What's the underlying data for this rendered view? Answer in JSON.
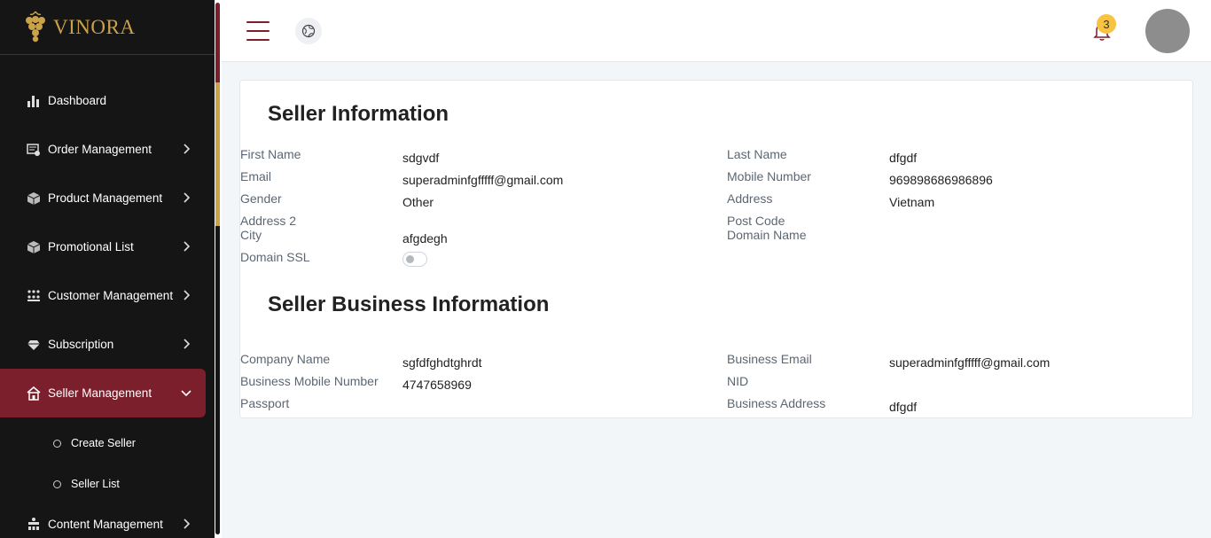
{
  "brand": {
    "name": "VINORA"
  },
  "sidebar": {
    "items": [
      {
        "label": "Dashboard",
        "icon": "bar-chart-icon"
      },
      {
        "label": "Order Management",
        "icon": "order-icon"
      },
      {
        "label": "Product Management",
        "icon": "box-icon"
      },
      {
        "label": "Promotional List",
        "icon": "box-icon"
      },
      {
        "label": "Customer Management",
        "icon": "users-icon"
      },
      {
        "label": "Subscription",
        "icon": "diamond-icon"
      },
      {
        "label": "Seller Management",
        "icon": "store-icon"
      },
      {
        "label": "Content Management",
        "icon": "content-icon"
      }
    ],
    "sub_items": [
      {
        "label": "Create Seller"
      },
      {
        "label": "Seller List"
      }
    ]
  },
  "header": {
    "notifications_count": "3"
  },
  "seller_info": {
    "title": "Seller Information",
    "first_name_label": "First Name",
    "first_name": "sdgvdf",
    "last_name_label": "Last Name",
    "last_name": "dfgdf",
    "email_label": "Email",
    "email": "superadminfgfffff@gmail.com",
    "mobile_label": "Mobile Number",
    "mobile": "969898686986896",
    "gender_label": "Gender",
    "gender": "Other",
    "address_label": "Address",
    "address": "Vietnam",
    "address2_label": "Address 2",
    "postcode_label": "Post Code",
    "city_label": "City",
    "city": "afgdegh",
    "domain_name_label": "Domain Name",
    "domain_ssl_label": "Domain SSL",
    "domain_ssl_enabled": false
  },
  "business_info": {
    "title": "Seller Business Information",
    "company_label": "Company Name",
    "company": "sgfdfghdtghrdt",
    "business_email_label": "Business Email",
    "business_email": "superadminfgfffff@gmail.com",
    "business_mobile_label": "Business Mobile Number",
    "business_mobile": "4747658969",
    "nid_label": "NID",
    "passport_label": "Passport",
    "business_address_label": "Business Address",
    "business_address": "dfgdf"
  },
  "colors": {
    "accent": "#7a1f2b",
    "gold": "#c9a24a",
    "sidebar_bg": "#151515",
    "badge": "#f6c343"
  }
}
